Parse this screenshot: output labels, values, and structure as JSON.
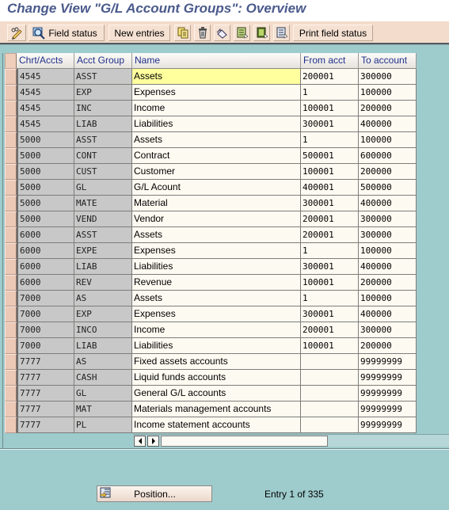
{
  "title": "Change View \"G/L Account Groups\": Overview",
  "toolbar": {
    "buttons": [
      {
        "icon": "pencil-glasses-icon",
        "label": ""
      },
      {
        "icon": "magnifier-icon",
        "label": "Field status"
      },
      {
        "icon": "",
        "label": "New entries"
      },
      {
        "icon": "copy-icon",
        "label": ""
      },
      {
        "icon": "trash-icon",
        "label": ""
      },
      {
        "icon": "undo-icon",
        "label": ""
      },
      {
        "icon": "select-all-icon",
        "label": ""
      },
      {
        "icon": "select-block-icon",
        "label": ""
      },
      {
        "icon": "deselect-all-icon",
        "label": ""
      },
      {
        "icon": "",
        "label": "Print field status"
      }
    ]
  },
  "table": {
    "columns": [
      "Chrt/Accts",
      "Acct Group",
      "Name",
      "From acct",
      "To account"
    ],
    "rows": [
      [
        "4545",
        "ASST",
        "Assets",
        "200001",
        "300000"
      ],
      [
        "4545",
        "EXP",
        "Expenses",
        "1",
        "100000"
      ],
      [
        "4545",
        "INC",
        "Income",
        "100001",
        "200000"
      ],
      [
        "4545",
        "LIAB",
        "Liabilities",
        "300001",
        "400000"
      ],
      [
        "5000",
        "ASST",
        "Assets",
        "1",
        "100000"
      ],
      [
        "5000",
        "CONT",
        "Contract",
        "500001",
        "600000"
      ],
      [
        "5000",
        "CUST",
        "Customer",
        "100001",
        "200000"
      ],
      [
        "5000",
        "GL",
        "G/L Acount",
        "400001",
        "500000"
      ],
      [
        "5000",
        "MATE",
        "Material",
        "300001",
        "400000"
      ],
      [
        "5000",
        "VEND",
        "Vendor",
        "200001",
        "300000"
      ],
      [
        "6000",
        "ASST",
        "Assets",
        "200001",
        "300000"
      ],
      [
        "6000",
        "EXPE",
        "Expenses",
        "1",
        "100000"
      ],
      [
        "6000",
        "LIAB",
        "Liabilities",
        "300001",
        "400000"
      ],
      [
        "6000",
        "REV",
        "Revenue",
        "100001",
        "200000"
      ],
      [
        "7000",
        "AS",
        "Assets",
        "1",
        "100000"
      ],
      [
        "7000",
        "EXP",
        "Expenses",
        "300001",
        "400000"
      ],
      [
        "7000",
        "INCO",
        "Income",
        "200001",
        "300000"
      ],
      [
        "7000",
        "LIAB",
        "Liabilities",
        "100001",
        "200000"
      ],
      [
        "7777",
        "AS",
        "Fixed assets accounts",
        "",
        "99999999"
      ],
      [
        "7777",
        "CASH",
        "Liquid funds accounts",
        "",
        "99999999"
      ],
      [
        "7777",
        "GL",
        "General G/L accounts",
        "",
        "99999999"
      ],
      [
        "7777",
        "MAT",
        "Materials management accounts",
        "",
        "99999999"
      ],
      [
        "7777",
        "PL",
        "Income statement accounts",
        "",
        "99999999"
      ]
    ],
    "highlighted_row": 0
  },
  "footer": {
    "position_label": "Position...",
    "entry_text": "Entry 1 of 335"
  },
  "colors": {
    "background": "#9ecbcc",
    "title": "#4a5a8c",
    "toolbar": "#f3dccb",
    "header_text": "#1f2f8a",
    "highlight": "#ffff9e"
  }
}
